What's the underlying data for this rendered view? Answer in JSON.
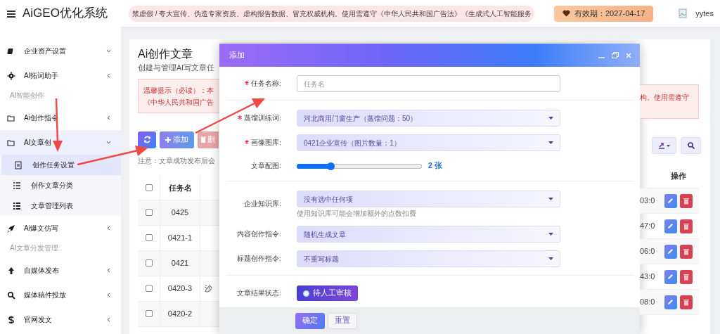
{
  "header": {
    "app_title": "AiGEO优化系统",
    "notice": "禁虚假 / 夸大宣传、伪造专家资质、虚构报告数据、冒充权威机构。使用需遵守《中华人民共和国广告法》《生成式人工智能服务",
    "validity": "有效期：2027-04-17",
    "user": "yytes"
  },
  "sidebar": {
    "items": [
      {
        "kind": "item",
        "label": "企业资产设置",
        "expanded": true
      },
      {
        "kind": "item",
        "label": "AI拓词助手",
        "expanded": false
      },
      {
        "kind": "section",
        "label": "AI智能创作"
      },
      {
        "kind": "item",
        "label": "Ai创作指令",
        "expanded": false
      },
      {
        "kind": "item",
        "label": "AI文章创",
        "expanded": true,
        "children": [
          {
            "label": "创作任务设置",
            "selected": true
          },
          {
            "label": "创作文章分类",
            "selected": false
          },
          {
            "label": "文章管理列表",
            "selected": false
          }
        ]
      },
      {
        "kind": "item",
        "label": "Ai爆文仿写",
        "expanded": false
      },
      {
        "kind": "section",
        "label": "AI文章分发管理"
      },
      {
        "kind": "item",
        "label": "自媒体发布",
        "expanded": false
      },
      {
        "kind": "item",
        "label": "媒体稿件投放",
        "expanded": false
      },
      {
        "kind": "item",
        "label": "官网发文",
        "expanded": false
      }
    ]
  },
  "page": {
    "title": "Ai创作文章",
    "subtitle": "创建与管理AI写文章任",
    "alert_left": [
      "温馨提示（必读）：本",
      "《中华人民共和国广告"
    ],
    "alert_right": "构。使用需遵守",
    "buttons": [
      "添加",
      "删"
    ],
    "note": "注意：文章成功发布后会",
    "table": {
      "columns": [
        "任务名",
        "操作"
      ],
      "header_checked": false,
      "rows": [
        {
          "task_name": "0425",
          "time": "03:0",
          "checked": false
        },
        {
          "task_name": "0421-1",
          "time": "47:0",
          "checked": false
        },
        {
          "task_name": "0421",
          "time": "06:0",
          "checked": false
        },
        {
          "task_name": "0420-3",
          "column_3": "沙",
          "time": "43:0",
          "checked": false
        },
        {
          "task_name": "0420-2",
          "time": "08:0",
          "checked": false
        }
      ]
    }
  },
  "modal": {
    "title": "添加",
    "fields": [
      {
        "kind": "text",
        "label": "任务名称:",
        "required": true,
        "placeholder": "任务名",
        "divider_after": true
      },
      {
        "kind": "select",
        "label": "蒸馏训练词:",
        "required": true,
        "value": "河北商用门窗生产（蒸馏问题：50）"
      },
      {
        "kind": "select",
        "label": "画像图库:",
        "required": true,
        "value": "0421企业宣传（图片数量：1）"
      },
      {
        "kind": "slider",
        "label": "文章配图:",
        "required": false,
        "level": 0.27,
        "reading": "2 张",
        "divider_after": true
      },
      {
        "kind": "select",
        "label": "企业知识库:",
        "required": false,
        "value": "没有选中任何项",
        "help": "使用知识库可能会增加额外的点数扣费"
      },
      {
        "kind": "select",
        "label": "内容创作指令:",
        "required": false,
        "value": "随机生成文章"
      },
      {
        "kind": "select",
        "label": "标题创作指令:",
        "required": false,
        "value": "不重写标题",
        "divider_after": true
      },
      {
        "kind": "radio",
        "label": "文章结果状态:",
        "required": false,
        "value": "待人工审核",
        "selected": true
      }
    ],
    "buttons": [
      "确定",
      "重置"
    ]
  }
}
